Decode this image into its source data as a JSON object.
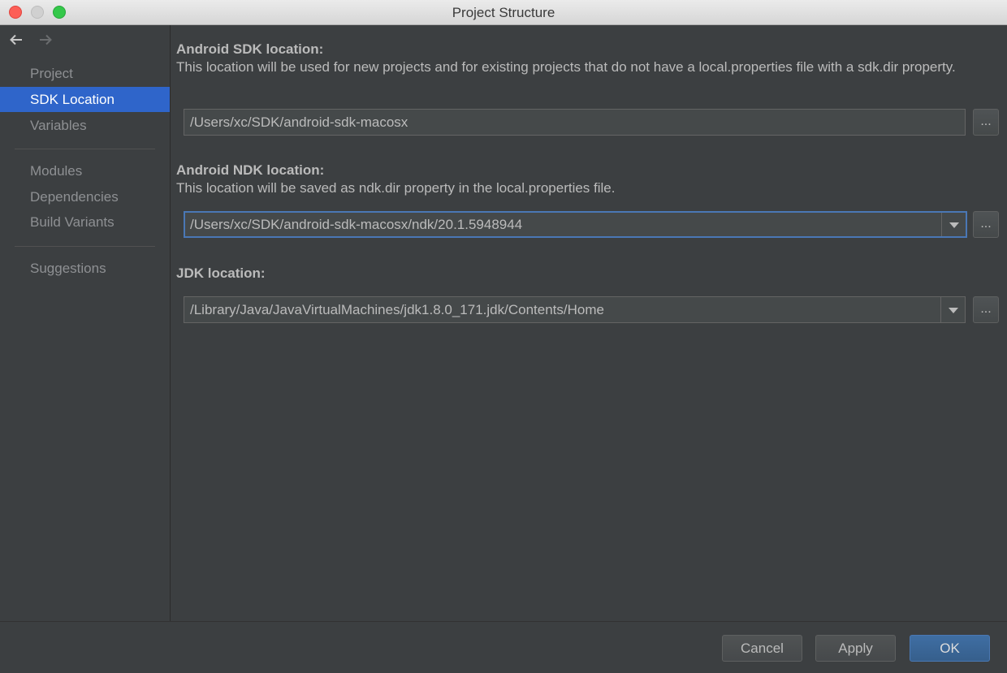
{
  "window": {
    "title": "Project Structure"
  },
  "sidebar": {
    "items": [
      {
        "label": "Project"
      },
      {
        "label": "SDK Location"
      },
      {
        "label": "Variables"
      },
      {
        "label": "Modules"
      },
      {
        "label": "Dependencies"
      },
      {
        "label": "Build Variants"
      },
      {
        "label": "Suggestions"
      }
    ],
    "selected": "SDK Location"
  },
  "main": {
    "sdk": {
      "title": "Android SDK location:",
      "description": "This location will be used for new projects and for existing projects that do not have a local.properties file with a sdk.dir property.",
      "value": "/Users/xc/SDK/android-sdk-macosx",
      "browse_label": "..."
    },
    "ndk": {
      "title": "Android NDK location:",
      "description": "This location will be saved as ndk.dir property in the local.properties file.",
      "value": "/Users/xc/SDK/android-sdk-macosx/ndk/20.1.5948944",
      "browse_label": "..."
    },
    "jdk": {
      "title": "JDK location:",
      "value": "/Library/Java/JavaVirtualMachines/jdk1.8.0_171.jdk/Contents/Home",
      "browse_label": "..."
    }
  },
  "footer": {
    "cancel_label": "Cancel",
    "apply_label": "Apply",
    "ok_label": "OK"
  },
  "colors": {
    "background": "#3c3f41",
    "selection": "#2f65ca",
    "focus_border": "#4a77b5",
    "ok_button": "#3f6ea3"
  }
}
